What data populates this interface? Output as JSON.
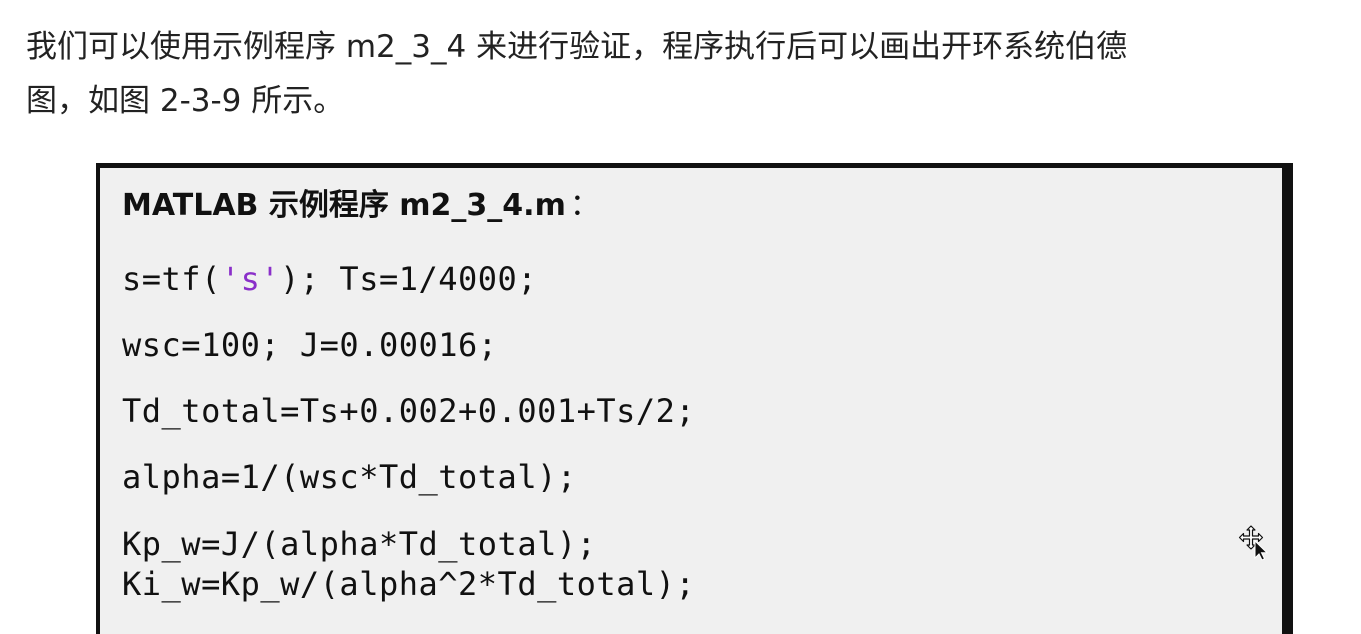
{
  "paragraph": {
    "line1": "我们可以使用示例程序 m2_3_4 来进行验证，程序执行后可以画出开环系统伯德",
    "line2": "图，如图 2-3-9 所示。"
  },
  "code_box": {
    "title": "MATLAB 示例程序 m2_3_4.m",
    "title_colon": "：",
    "line1_pre": "s=tf(",
    "line1_str": "'s'",
    "line1_post": "); Ts=1/4000;",
    "line2": "wsc=100; J=0.00016;",
    "line3": "Td_total=Ts+0.002+0.001+Ts/2;",
    "line4": "alpha=1/(wsc*Td_total);",
    "line5": "Kp_w=J/(alpha*Td_total);",
    "line6": "Ki_w=Kp_w/(alpha^2*Td_total);"
  },
  "colors": {
    "string_literal": "#8a2fc9",
    "box_background": "#f0f0f0",
    "box_border": "#111111"
  },
  "icons": {
    "cursor": "move-cursor-icon"
  }
}
